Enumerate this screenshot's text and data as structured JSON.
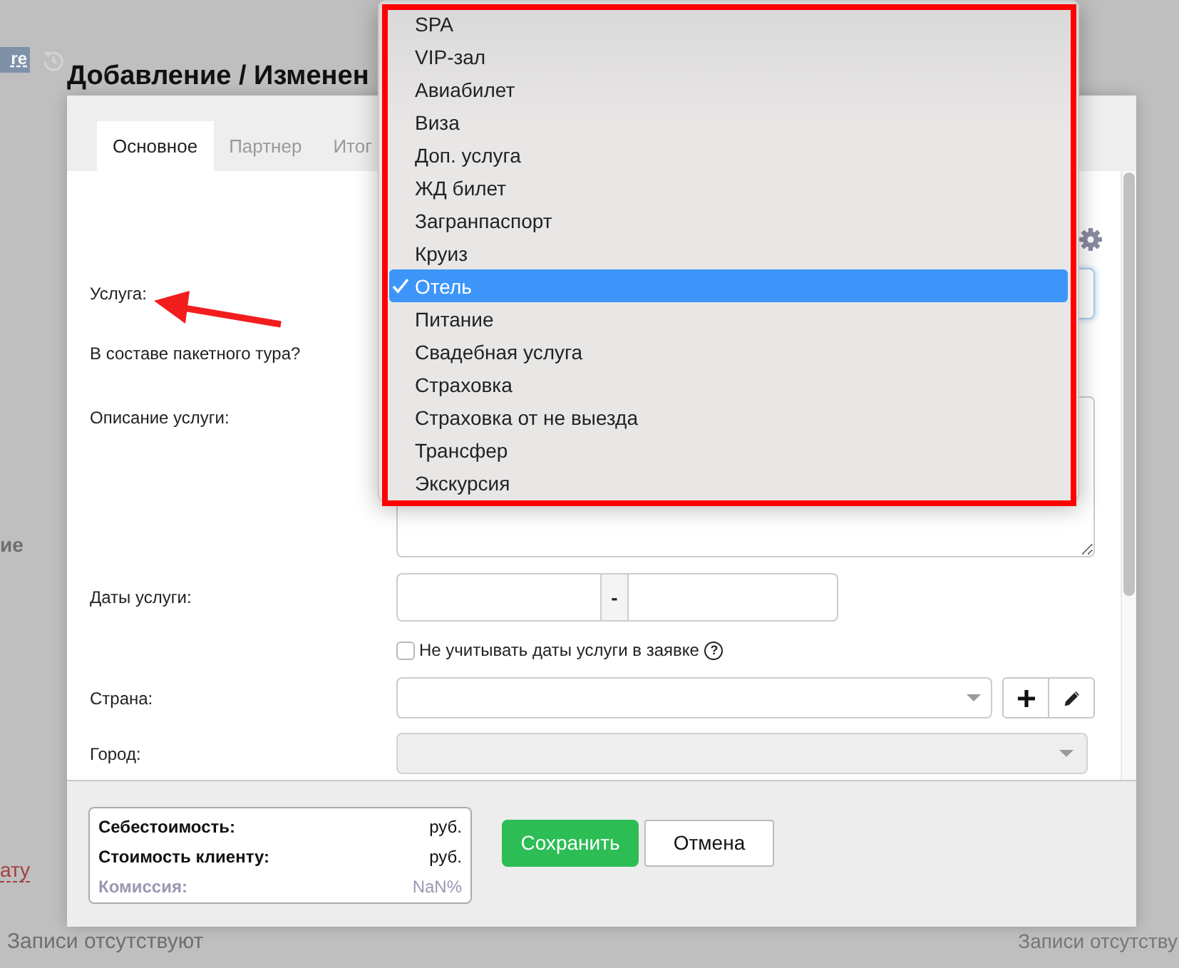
{
  "background_page": {
    "toolbar_button": "re",
    "section_label": "ие",
    "link": "ату",
    "empty_state_left": "Записи отсутствуют",
    "empty_state_right": "Записи отсутству"
  },
  "dialog": {
    "title": "Добавление / Изменен",
    "tabs": [
      {
        "label": "Основное",
        "selected": true
      },
      {
        "label": "Партнер",
        "selected": false
      },
      {
        "label": "Итог",
        "selected": false
      }
    ],
    "fields": [
      {
        "kind": "select",
        "label": "Услуга:",
        "disabled": false
      },
      {
        "kind": "question",
        "label": "В составе пакетного тура?"
      },
      {
        "kind": "textarea",
        "label": "Описание услуги:"
      },
      {
        "kind": "date_range",
        "label": "Даты услуги:",
        "separator": "-"
      },
      {
        "kind": "checkbox",
        "label": "Не учитывать даты услуги в заявке",
        "checked": false,
        "hint": "?"
      },
      {
        "kind": "select_actions",
        "label": "Страна:",
        "disabled": false
      },
      {
        "kind": "select",
        "label": "Город:",
        "disabled": true
      }
    ],
    "summary": [
      {
        "kind": "total",
        "label": "Себестоимость:",
        "value": "руб."
      },
      {
        "kind": "total",
        "label": "Стоимость клиенту:",
        "value": "руб."
      },
      {
        "kind": "muted",
        "label": "Комиссия:",
        "value": "NaN%"
      }
    ],
    "buttons": [
      {
        "kind": "primary",
        "label": "Сохранить"
      },
      {
        "kind": "secondary",
        "label": "Отмена"
      }
    ]
  },
  "dropdown": {
    "options": [
      {
        "label": "SPA",
        "selected": false
      },
      {
        "label": "VIP-зал",
        "selected": false
      },
      {
        "label": "Авиабилет",
        "selected": false
      },
      {
        "label": "Виза",
        "selected": false
      },
      {
        "label": "Доп. услуга",
        "selected": false
      },
      {
        "label": "ЖД билет",
        "selected": false
      },
      {
        "label": "Загранпаспорт",
        "selected": false
      },
      {
        "label": "Круиз",
        "selected": false
      },
      {
        "label": "Отель",
        "selected": true
      },
      {
        "label": "Питание",
        "selected": false
      },
      {
        "label": "Свадебная услуга",
        "selected": false
      },
      {
        "label": "Страховка",
        "selected": false
      },
      {
        "label": "Страховка от не выезда",
        "selected": false
      },
      {
        "label": "Трансфер",
        "selected": false
      },
      {
        "label": "Экскурсия",
        "selected": false
      }
    ]
  }
}
